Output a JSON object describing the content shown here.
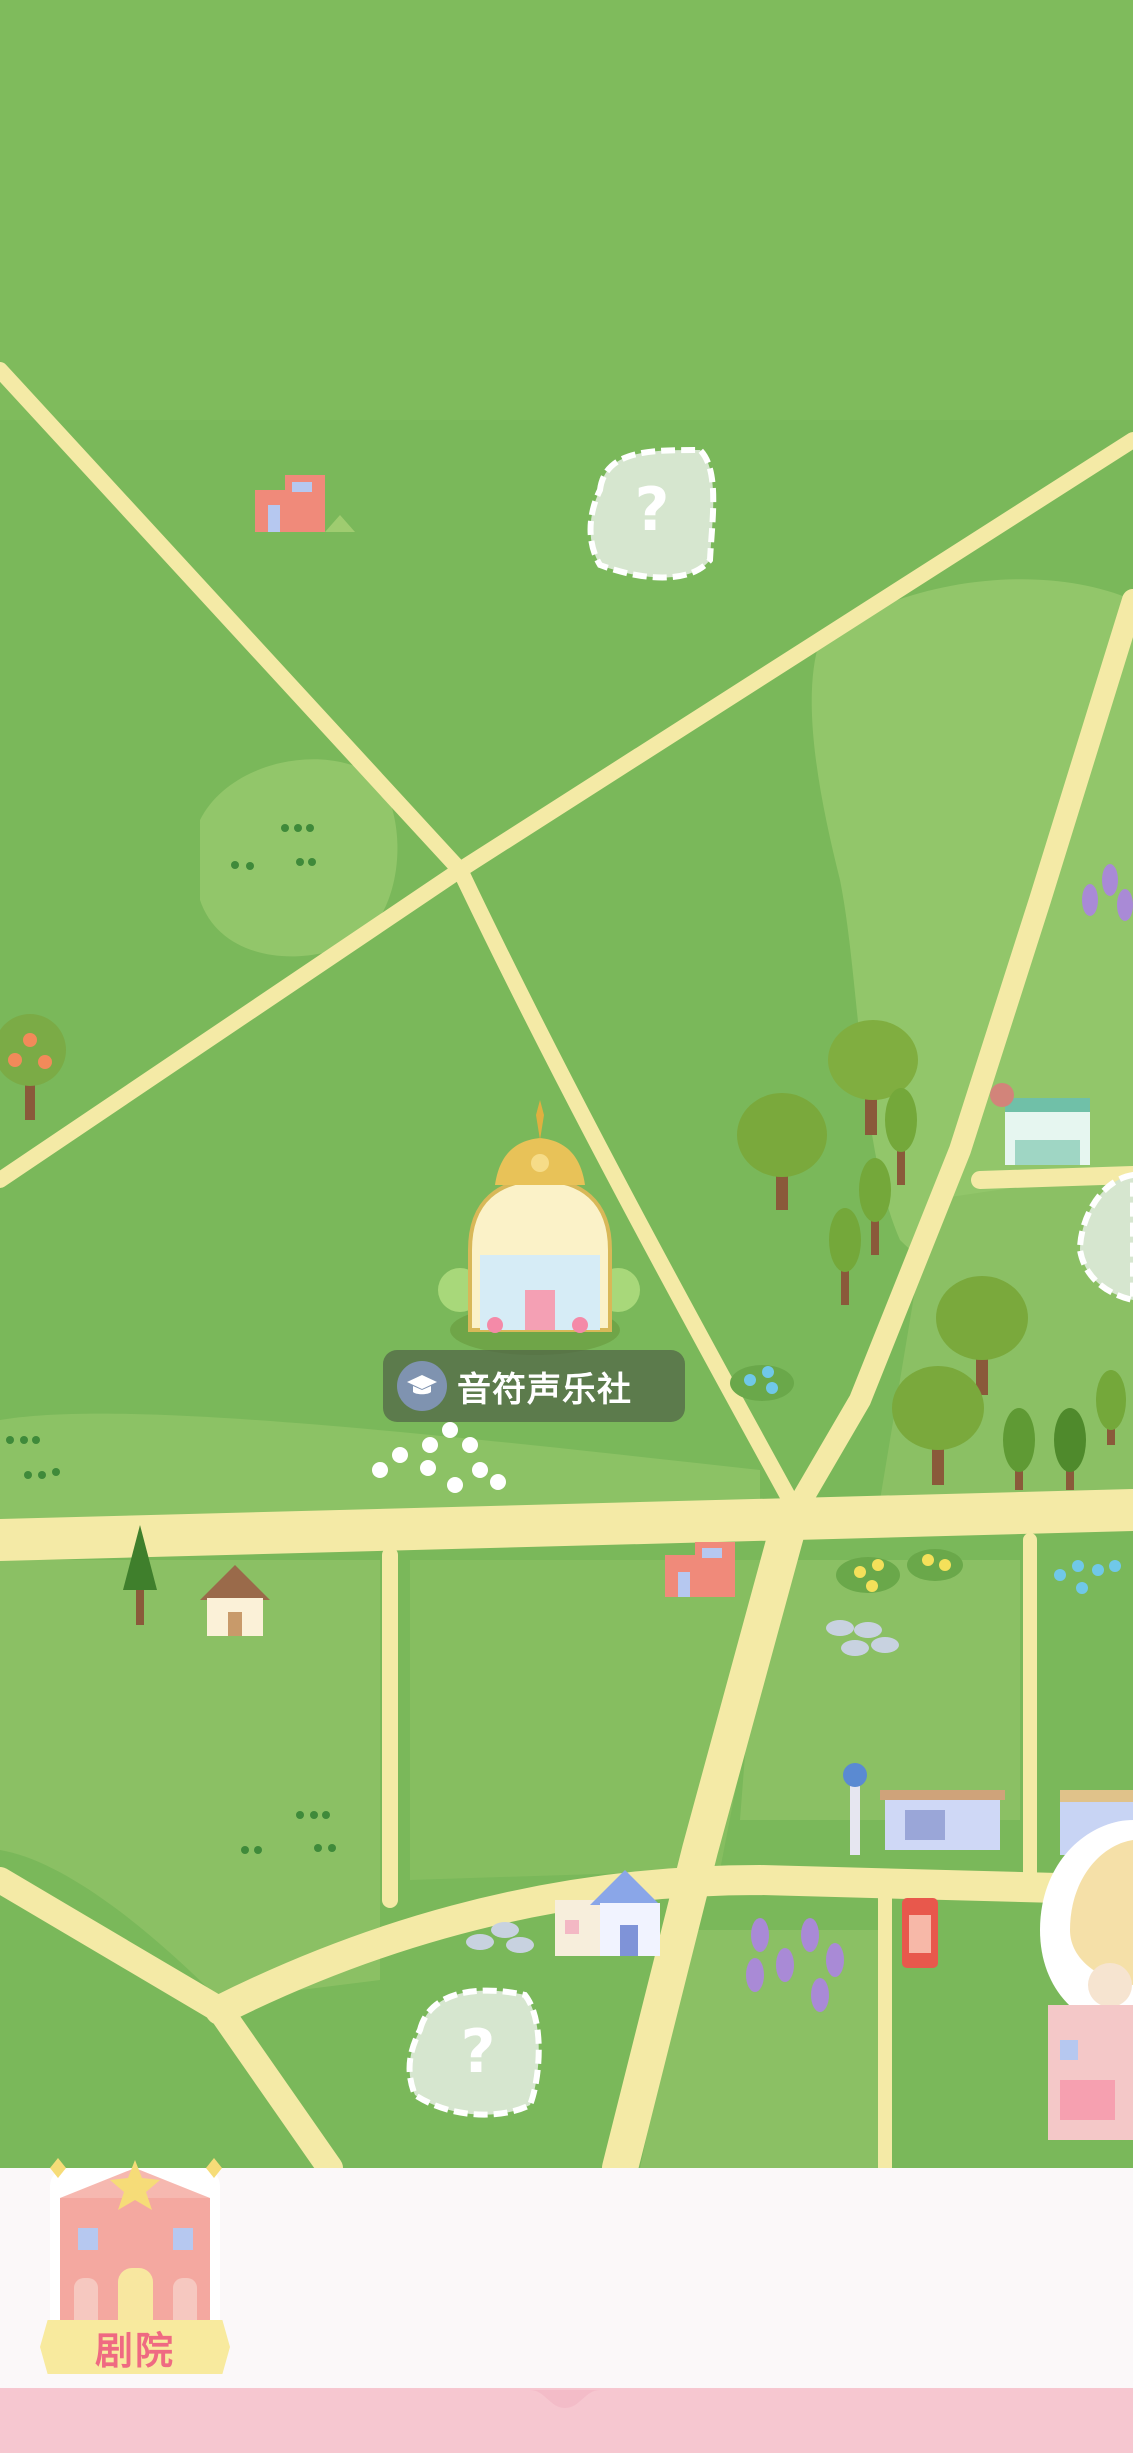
{
  "map": {
    "featured_location": {
      "name": "音符声乐社",
      "icon": "graduation-cap-icon"
    },
    "unknown_locations": [
      {
        "label": "?"
      },
      {
        "label": "?"
      }
    ],
    "colors": {
      "grass": "#7ab85a",
      "grass_light": "#92c66a",
      "road": "#f4eaa6"
    }
  },
  "bottom_panel": {
    "theatre_label": "剧院"
  }
}
